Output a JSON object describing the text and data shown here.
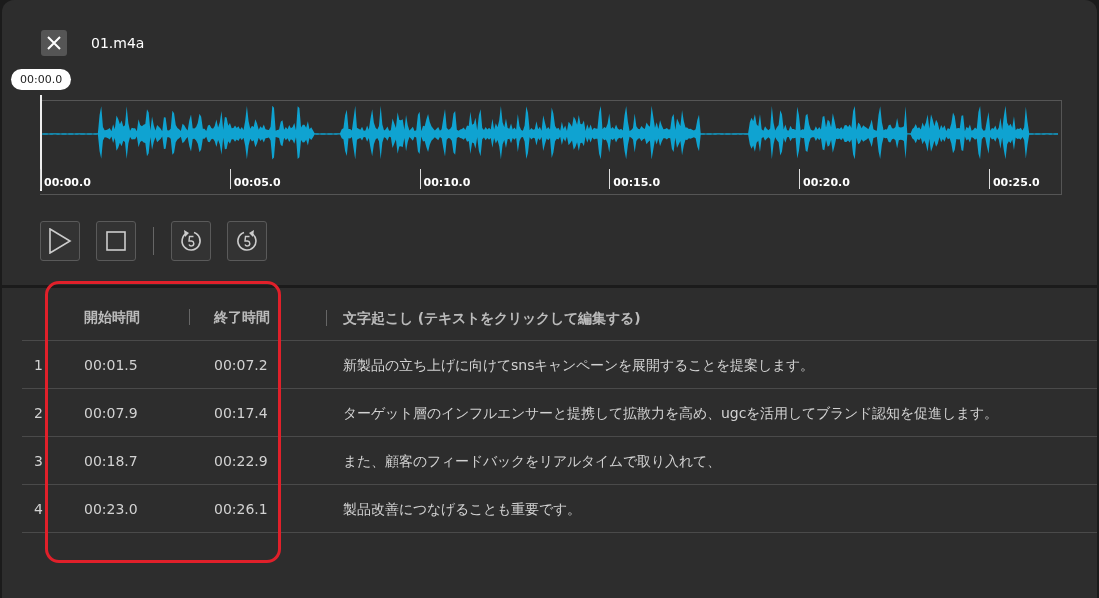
{
  "header": {
    "file_name": "01.m4a"
  },
  "player": {
    "cursor_time": "00:00.0",
    "ticks": [
      "00:00.0",
      "00:05.0",
      "00:10.0",
      "00:15.0",
      "00:20.0",
      "00:25.0"
    ]
  },
  "table": {
    "columns": [
      "開始時間",
      "終了時間",
      "文字起こし (テキストをクリックして編集する)"
    ],
    "rows": [
      {
        "index": "1",
        "start": "00:01.5",
        "end": "00:07.2",
        "text": "新製品の立ち上げに向けてsnsキャンペーンを展開することを提案します。"
      },
      {
        "index": "2",
        "start": "00:07.9",
        "end": "00:17.4",
        "text": "ターゲット層のインフルエンサーと提携して拡散力を高め、ugcを活用してブランド認知を促進します。"
      },
      {
        "index": "3",
        "start": "00:18.7",
        "end": "00:22.9",
        "text": "また、顧客のフィードバックをリアルタイムで取り入れて、"
      },
      {
        "index": "4",
        "start": "00:23.0",
        "end": "00:26.1",
        "text": "製品改善につなげることも重要です。"
      }
    ]
  }
}
